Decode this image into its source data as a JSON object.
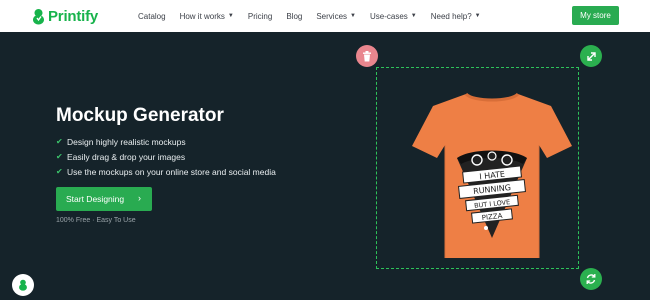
{
  "colors": {
    "brand_green": "#29ab51",
    "hero_bg": "#15232a",
    "shirt": "#ee7f45",
    "delete_pink": "#e9868e"
  },
  "nav": {
    "logo_text": "Printify",
    "logo_icon": "printify-logo-icon",
    "items": [
      {
        "label": "Catalog",
        "dropdown": false
      },
      {
        "label": "How it works",
        "dropdown": true
      },
      {
        "label": "Pricing",
        "dropdown": false
      },
      {
        "label": "Blog",
        "dropdown": false
      },
      {
        "label": "Services",
        "dropdown": true
      },
      {
        "label": "Use-cases",
        "dropdown": true
      },
      {
        "label": "Need help?",
        "dropdown": true
      }
    ],
    "my_store": "My store"
  },
  "hero": {
    "title": "Mockup Generator",
    "features": [
      "Design highly realistic mockups",
      "Easily drag & drop your images",
      "Use the mockups on your online store and social media"
    ],
    "cta": "Start Designing",
    "subtext": "100% Free · Easy To Use"
  },
  "mockup": {
    "shirt_text": [
      "I HATE",
      "RUNNING",
      "BUT I LOVE",
      "PIZZA"
    ],
    "icons": {
      "delete": "trash-icon",
      "resize": "resize-arrows-icon",
      "rotate": "rotate-icon"
    }
  }
}
